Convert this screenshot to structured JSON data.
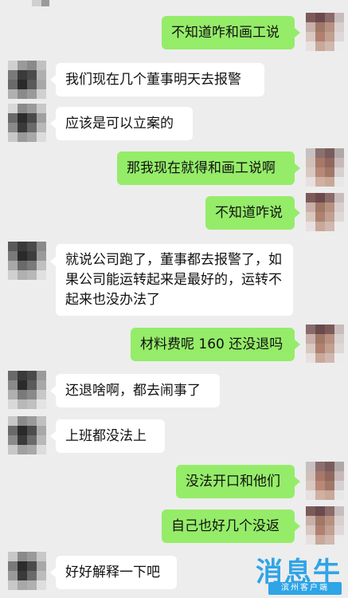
{
  "messages": [
    {
      "side": "right",
      "text": "不知道咋和画工说"
    },
    {
      "side": "left",
      "text": "我们现在几个董事明天去报警"
    },
    {
      "side": "left",
      "text": "应该是可以立案的"
    },
    {
      "side": "right",
      "text": "那我现在就得和画工说啊"
    },
    {
      "side": "right",
      "text": "不知道咋说"
    },
    {
      "side": "left",
      "text": "就说公司跑了，董事都去报警了，如果公司能运转起来是最好的，运转不起来也没办法了"
    },
    {
      "side": "right",
      "text": "材料费呢 160 还没退吗"
    },
    {
      "side": "left",
      "text": "还退啥啊，都去闹事了"
    },
    {
      "side": "left",
      "text": "上班都没法上"
    },
    {
      "side": "right",
      "text": "没法开口和他们"
    },
    {
      "side": "right",
      "text": "自己也好几个没返"
    },
    {
      "side": "left",
      "text": "好好解释一下吧"
    }
  ],
  "watermark": {
    "brand": "消息牛",
    "subtitle": "滨州客户端"
  },
  "colors": {
    "background": "#ededed",
    "bubble_right": "#95ec69",
    "bubble_left": "#ffffff",
    "watermark": "#2fa4e7"
  }
}
